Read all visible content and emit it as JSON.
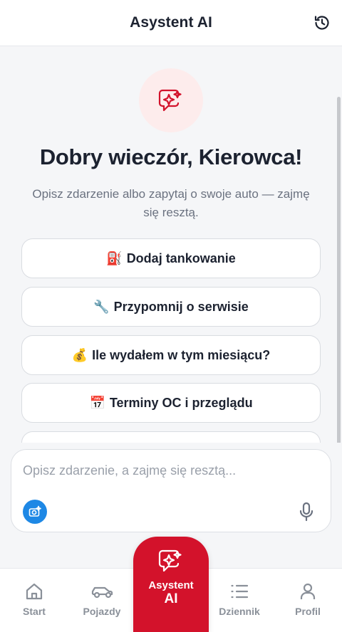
{
  "header": {
    "title": "Asystent AI"
  },
  "hero": {
    "greeting": "Dobry wieczór, Kierowca!",
    "subtitle": "Opisz zdarzenie albo zapytaj o swoje auto — zajmę się resztą."
  },
  "suggestions": [
    {
      "emoji": "⛽",
      "label": "Dodaj tankowanie"
    },
    {
      "emoji": "🔧",
      "label": "Przypomnij o serwisie"
    },
    {
      "emoji": "💰",
      "label": "Ile wydałem w tym miesiącu?"
    },
    {
      "emoji": "📅",
      "label": "Terminy OC i przeglądu"
    },
    {
      "emoji": "",
      "label": ""
    }
  ],
  "composer": {
    "placeholder": "Opisz zdarzenie, a zajmę się resztą...",
    "value": ""
  },
  "nav": {
    "start": "Start",
    "pojazdy": "Pojazdy",
    "center_line1": "Asystent",
    "center_line2": "AI",
    "dziennik": "Dziennik",
    "profil": "Profil",
    "active": "Asystent AI"
  },
  "colors": {
    "accent": "#d3122b",
    "scan_button": "#1e88e5",
    "badge_bg": "#fdecec"
  }
}
